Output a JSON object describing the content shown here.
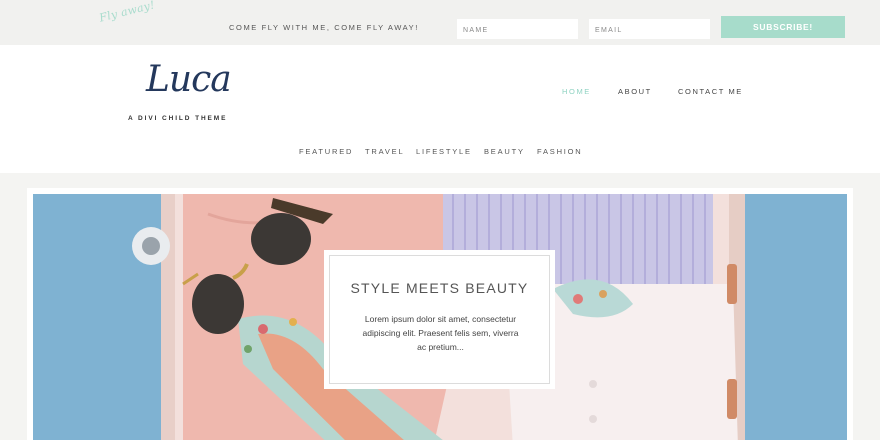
{
  "topbar": {
    "script_text": "Fly away!",
    "tagline": "COME FLY WITH ME, COME FLY AWAY!",
    "name_placeholder": "NAME",
    "email_placeholder": "EMAIL",
    "subscribe_label": "SUBSCRIBE!"
  },
  "header": {
    "logo_text": "Luca",
    "logo_tagline": "A DIVI CHILD THEME",
    "main_nav": [
      "HOME",
      "ABOUT",
      "CONTACT ME"
    ],
    "category_nav": [
      "FEATURED",
      "TRAVEL",
      "LIFESTYLE",
      "BEAUTY",
      "FASHION"
    ]
  },
  "hero": {
    "title": "STYLE MEETS BEAUTY",
    "text": "Lorem ipsum dolor sit amet, consectetur adipiscing elit. Praesent felis sem, viverra ac pretium..."
  },
  "colors": {
    "accent": "#a7dccb",
    "active_nav": "#8fd3c2",
    "logo": "#24385c",
    "hero_background": "#7fb0d0"
  }
}
